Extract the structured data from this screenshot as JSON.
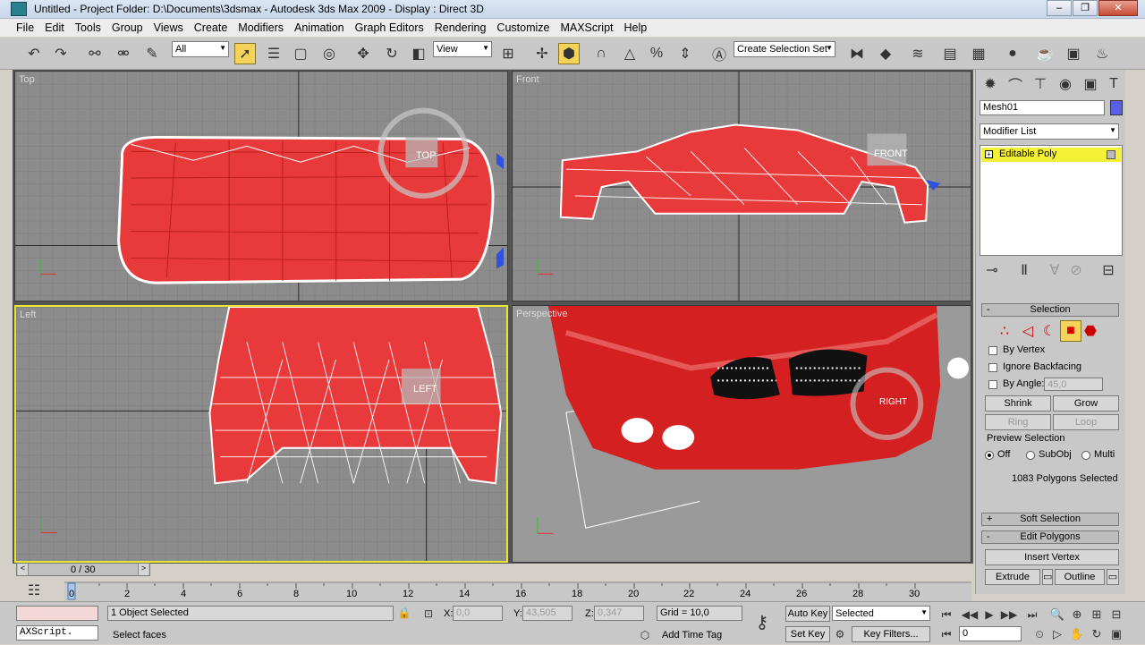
{
  "window": {
    "title": "Untitled      - Project Folder: D:\\Documents\\3dsmax      - Autodesk 3ds Max  2009      - Display : Direct 3D"
  },
  "menu": [
    "File",
    "Edit",
    "Tools",
    "Group",
    "Views",
    "Create",
    "Modifiers",
    "Animation",
    "Graph Editors",
    "Rendering",
    "Customize",
    "MAXScript",
    "Help"
  ],
  "toolbar": {
    "filter": "All",
    "reference": "View",
    "selection_set": "Create Selection Set"
  },
  "viewports": {
    "top": "Top",
    "front": "Front",
    "left": "Left",
    "perspective": "Perspective",
    "viewcube_top": "TOP",
    "viewcube_front": "FRONT",
    "viewcube_left": "LEFT",
    "viewcube_right": "RIGHT"
  },
  "command_panel": {
    "object_name": "Mesh01",
    "modifier_list": "Modifier List",
    "stack_item": "Editable Poly",
    "selection_title": "Selection",
    "by_vertex": "By Vertex",
    "ignore_backfacing": "Ignore Backfacing",
    "by_angle": "By Angle:",
    "angle_value": "45,0",
    "shrink": "Shrink",
    "grow": "Grow",
    "ring": "Ring",
    "loop": "Loop",
    "preview_selection": "Preview Selection",
    "off": "Off",
    "subobj": "SubObj",
    "multi": "Multi",
    "poly_count": "1083 Polygons Selected",
    "soft_selection": "Soft Selection",
    "edit_polygons": "Edit Polygons",
    "insert_vertex": "Insert Vertex",
    "extrude": "Extrude",
    "outline": "Outline"
  },
  "timeline": {
    "slider": "0 / 30",
    "ticks": [
      "0",
      "2",
      "4",
      "6",
      "8",
      "10",
      "12",
      "14",
      "16",
      "18",
      "20",
      "22",
      "24",
      "26",
      "28",
      "30"
    ]
  },
  "status": {
    "maxscript": "AXScript.",
    "selected": "1 Object Selected",
    "prompt": "Select faces",
    "x_label": "X:",
    "x": "0,0",
    "y_label": "Y:",
    "y": "43,505",
    "z_label": "Z:",
    "z": "0,347",
    "grid": "Grid = 10,0",
    "add_time_tag": "Add Time Tag",
    "auto_key": "Auto Key",
    "selected_dd": "Selected",
    "set_key": "Set Key",
    "key_filters": "Key Filters...",
    "frame": "0"
  },
  "colors": {
    "mesh": "#e83a3a",
    "wire": "#ffffff",
    "viewport_bg": "#8c8c8c",
    "active_border": "#e8e830",
    "stack_highlight": "#f4f037"
  }
}
